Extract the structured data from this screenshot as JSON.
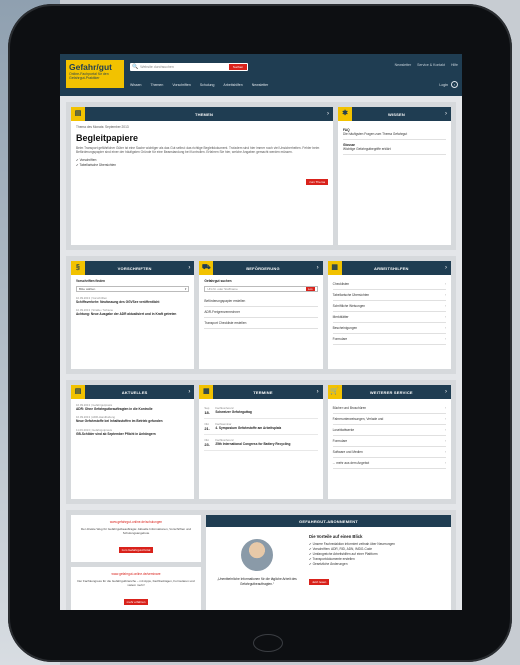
{
  "header": {
    "logo_main": "Gefahr/gut",
    "logo_sub": "Online-Fachportal für den Gefahrgut-Praktiker",
    "search_placeholder": "Website durchsuchen",
    "search_button": "Suchen",
    "toplinks": [
      "Newsletter",
      "Service & Kontakt",
      "Hilfe"
    ],
    "nav": [
      "Wissen",
      "Themen",
      "Vorschriften",
      "Schulung",
      "Arbeitshilfen",
      "Newsletter"
    ],
    "login": "Login"
  },
  "themen": {
    "title": "THEMEN",
    "kicker": "Thema des Monats: September 2013",
    "headline": "Begleitpapiere",
    "text": "Beim Transport gefährlicher Güter ist eine Sache wichtiger als das Gut selbst: das richtige Begleitdokument. Trotzdem sind hier immer noch viel Unsicherheiten. Fehler beim Beförderungspapier sind einer der häufigsten Gründe für eine Beanstandung bei Kontrollen. Erfahren Sie hier, welche Angaben gemacht werden müssen.",
    "checks": [
      "Vorschriften",
      "Tabellarische Übersichten"
    ],
    "button": "zum Thema"
  },
  "wissen": {
    "title": "WISSEN",
    "items": [
      {
        "title": "FAQ",
        "text": "Die häufigsten Fragen zum Thema Gefahrgut"
      },
      {
        "title": "Glossar",
        "text": "Wichtige Gefahrgutbegriffe erklärt"
      }
    ]
  },
  "vorschriften": {
    "title": "VORSCHRIFTEN",
    "label": "Vorschriften finden",
    "select": "Bitte wählen",
    "news": [
      {
        "date": "10.09.2013 | Vorschriften",
        "title": "Schiffsverkehr: Neufassung des GGVSee veröffentlicht"
      },
      {
        "date": "10.09.2013 | Straße / Schiene",
        "title": "Achtung: Neue Ausgabe der ADR aktualisiert und in Kraft getreten"
      }
    ]
  },
  "befoerderung": {
    "title": "BEFÖRDERUNG",
    "label": "Gefahrgut suchen",
    "placeholder": "UN-Nr. oder Stoffname",
    "button": "Los",
    "links": [
      "Beförderungspapier erstellen",
      "ADR-Freigrenzenrechner",
      "Transport Checkliste erstellen"
    ]
  },
  "arbeitshilfen": {
    "title": "ARBEITSHILFEN",
    "items": [
      "Checklisten",
      "Tabellarische Übersichten",
      "Schriftliche Weisungen",
      "Merkblätter",
      "Bescheinigungen",
      "Formulare"
    ]
  },
  "aktuelles": {
    "title": "AKTUELLES",
    "news": [
      {
        "date": "16.09.2013 | Gefahrgutpraxis",
        "title": "ADR: Ohne Gefahrgutbeauftragten in die Kontrolle"
      },
      {
        "date": "16.09.2013 | ADR-Handhabung",
        "title": "Neue Gefahrstoffe bei Inhaltsstoffen im Betrieb gefunden"
      },
      {
        "date": "11.09.2013 | Gefahrgutpraxis",
        "title": "GB-Schilder sind ab September Pflicht in Anhängern"
      }
    ]
  },
  "termine": {
    "title": "TERMINE",
    "items": [
      {
        "month": "Sep",
        "day": "18.",
        "type": "Fachkonferenz",
        "title": "Schweizer Gefahrguttag"
      },
      {
        "month": "Okt",
        "day": "21.",
        "type": "Fachseminar",
        "title": "4. Symposium Gefahrstoffe am Arbeitsplatz"
      },
      {
        "month": "Okt",
        "day": "23.",
        "type": "Fachkonferenz",
        "title": "25th International Congress for Battery Recycling"
      }
    ]
  },
  "service": {
    "title": "WEITERER SERVICE",
    "items": [
      "Bücher und Broschüren",
      "Fahrerunterweisungen, Verlade und",
      "Loseblattwerke",
      "Formulare",
      "Software und Medien",
      "... mehr aus dem Angebot"
    ]
  },
  "promos": [
    {
      "link": "www.gefahrgut-online.de/schulungen",
      "text": "Der direkte Weg für Gefahrgutbeauftragte: Aktuelle Informationen, Vorschriften und Schulungsangebote",
      "button": "zum Gefahrgut-Portal"
    },
    {
      "link": "www.gefahrgut-online.de/seminare",
      "text": "Der Fachkongress für die Gefahrgutbranche – mit Apps, Fachbeiträgen, Formularen und vielem mehr!",
      "button": "mehr erfahren"
    }
  ],
  "abo": {
    "title": "GEFAHRGUT-ABONNEMENT",
    "quote": "„Unentbehrliche Informationen für die tägliche Arbeit des Gefahrgutbeauftragten.“",
    "benefits_title": "Die Vorteile auf einen Blick",
    "benefits": [
      "Unsere Fachredaktion informiert zeitnah über Neuerungen",
      "Vorschriften: ADR, RID, ADN, IMDG-Code",
      "Umfangreiche Arbeitshilfen auf einer Plattform",
      "Transportdokumente erstellen",
      "Gesetzliche Änderungen"
    ],
    "button": "Jetzt lesen"
  },
  "colors": {
    "navy": "#1f3d52",
    "yellow": "#f2c200",
    "red": "#d9221b"
  }
}
